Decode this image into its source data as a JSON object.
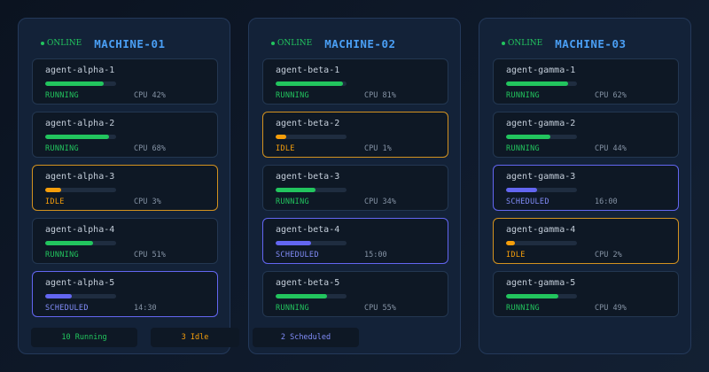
{
  "machines": [
    {
      "status": "ONLINE",
      "name": "MACHINE-01",
      "agents": [
        {
          "name": "agent-alpha-1",
          "state": "RUNNING",
          "metric": "CPU 42%",
          "load": 0.82
        },
        {
          "name": "agent-alpha-2",
          "state": "RUNNING",
          "metric": "CPU 68%",
          "load": 0.9
        },
        {
          "name": "agent-alpha-3",
          "state": "IDLE",
          "metric": "CPU 3%",
          "load": 0.22
        },
        {
          "name": "agent-alpha-4",
          "state": "RUNNING",
          "metric": "CPU 51%",
          "load": 0.68
        },
        {
          "name": "agent-alpha-5",
          "state": "SCHEDULED",
          "metric": "14:30",
          "load": 0.38
        }
      ]
    },
    {
      "status": "ONLINE",
      "name": "MACHINE-02",
      "agents": [
        {
          "name": "agent-beta-1",
          "state": "RUNNING",
          "metric": "CPU 81%",
          "load": 0.95
        },
        {
          "name": "agent-beta-2",
          "state": "IDLE",
          "metric": "CPU 1%",
          "load": 0.15
        },
        {
          "name": "agent-beta-3",
          "state": "RUNNING",
          "metric": "CPU 34%",
          "load": 0.56
        },
        {
          "name": "agent-beta-4",
          "state": "SCHEDULED",
          "metric": "15:00",
          "load": 0.5
        },
        {
          "name": "agent-beta-5",
          "state": "RUNNING",
          "metric": "CPU 55%",
          "load": 0.72
        }
      ]
    },
    {
      "status": "ONLINE",
      "name": "MACHINE-03",
      "agents": [
        {
          "name": "agent-gamma-1",
          "state": "RUNNING",
          "metric": "CPU 62%",
          "load": 0.88
        },
        {
          "name": "agent-gamma-2",
          "state": "RUNNING",
          "metric": "CPU 44%",
          "load": 0.62
        },
        {
          "name": "agent-gamma-3",
          "state": "SCHEDULED",
          "metric": "16:00",
          "load": 0.44
        },
        {
          "name": "agent-gamma-4",
          "state": "IDLE",
          "metric": "CPU 2%",
          "load": 0.12
        },
        {
          "name": "agent-gamma-5",
          "state": "RUNNING",
          "metric": "CPU 49%",
          "load": 0.74
        }
      ]
    }
  ],
  "summary": {
    "running": "10 Running",
    "idle": "3 Idle",
    "scheduled": "2 Scheduled"
  },
  "colors": {
    "running": "#22c55e",
    "idle": "#f59e0b",
    "scheduled": "#6366f1",
    "accent": "#4a9ff5"
  }
}
